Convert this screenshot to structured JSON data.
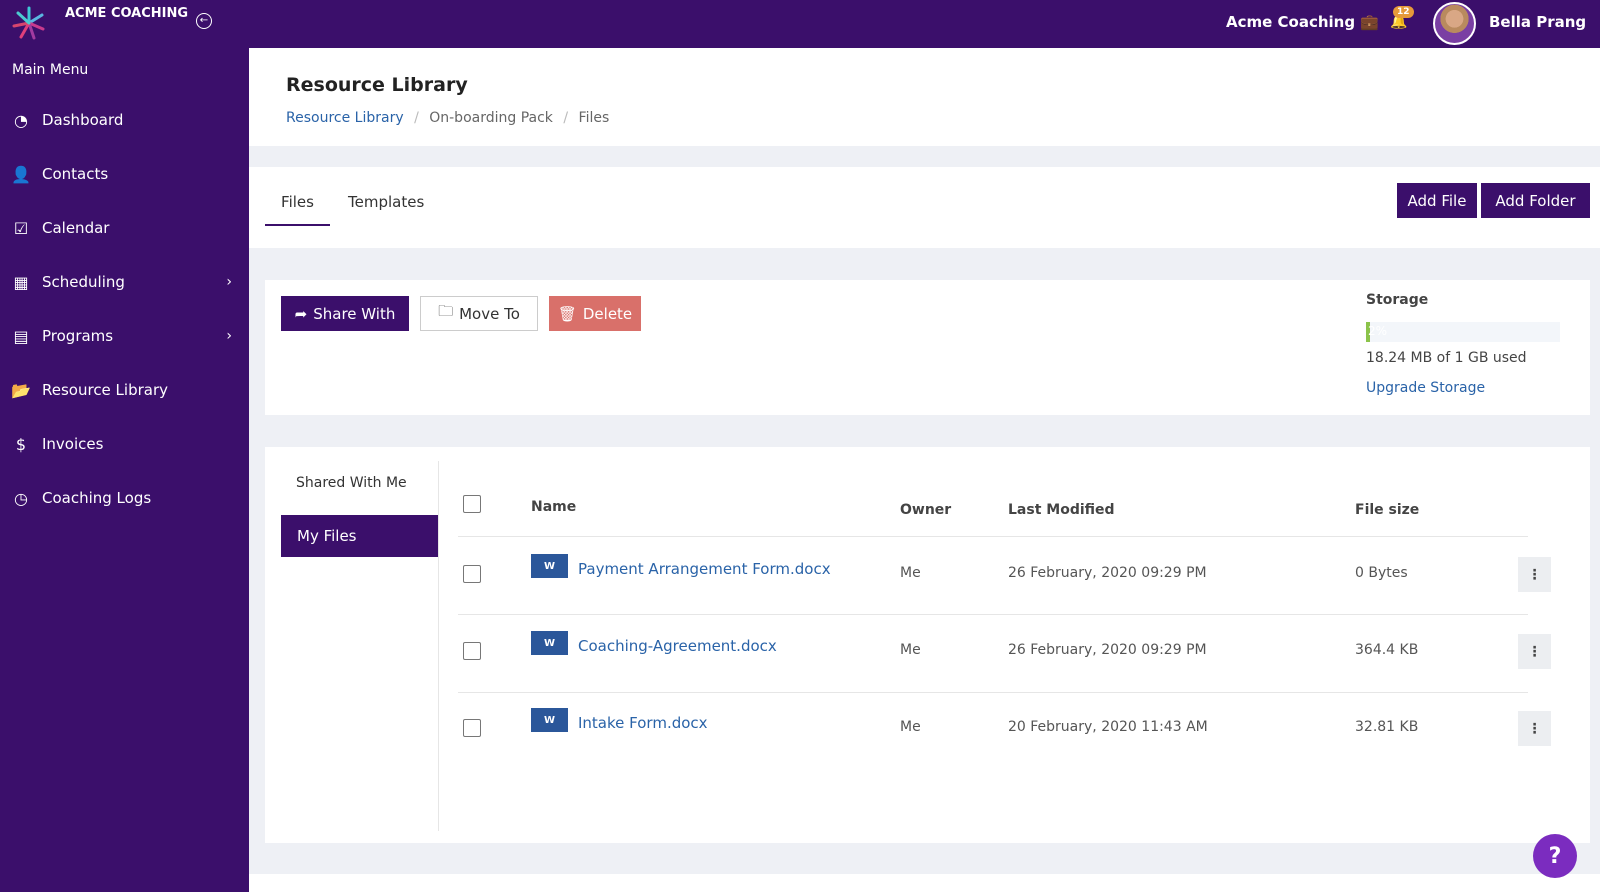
{
  "header": {
    "brand": "ACME COACHING",
    "org": "Acme Coaching",
    "notifications": "12",
    "user": "Bella Prang"
  },
  "sidebar": {
    "title": "Main Menu",
    "items": [
      {
        "label": "Dashboard",
        "icon": "gauge-icon"
      },
      {
        "label": "Contacts",
        "icon": "contacts-icon"
      },
      {
        "label": "Calendar",
        "icon": "calendar-check-icon"
      },
      {
        "label": "Scheduling",
        "icon": "calendar-grid-icon"
      },
      {
        "label": "Programs",
        "icon": "book-icon"
      },
      {
        "label": "Resource Library",
        "icon": "folder-open-icon"
      },
      {
        "label": "Invoices",
        "icon": "invoice-icon"
      },
      {
        "label": "Coaching Logs",
        "icon": "clock-icon"
      }
    ]
  },
  "page": {
    "title": "Resource Library",
    "breadcrumb": [
      "Resource Library",
      "On-boarding Pack",
      "Files"
    ]
  },
  "tabs": [
    "Files",
    "Templates"
  ],
  "actions": {
    "add_file": "Add File",
    "add_folder": "Add Folder",
    "share": "Share With",
    "move": "Move To",
    "delete": "Delete"
  },
  "storage": {
    "title": "Storage",
    "percent": 2,
    "percent_label": "2%",
    "used": "18.24 MB of 1 GB used",
    "upgrade": "Upgrade Storage"
  },
  "folders": [
    "Shared With Me",
    "My Files"
  ],
  "table": {
    "headers": [
      "Name",
      "Owner",
      "Last Modified",
      "File size"
    ],
    "rows": [
      {
        "name": "Payment Arrangement Form.docx",
        "owner": "Me",
        "modified": "26 February, 2020 09:29 PM",
        "size": "0 Bytes"
      },
      {
        "name": "Coaching-Agreement.docx",
        "owner": "Me",
        "modified": "26 February, 2020 09:29 PM",
        "size": "364.4 KB"
      },
      {
        "name": "Intake Form.docx",
        "owner": "Me",
        "modified": "20 February, 2020 11:43 AM",
        "size": "32.81 KB"
      }
    ]
  },
  "help": "?",
  "colors": {
    "brand": "#3b0f6b",
    "delete": "#d9706a",
    "link": "#2a63a8",
    "progress": "#8bc34a"
  }
}
